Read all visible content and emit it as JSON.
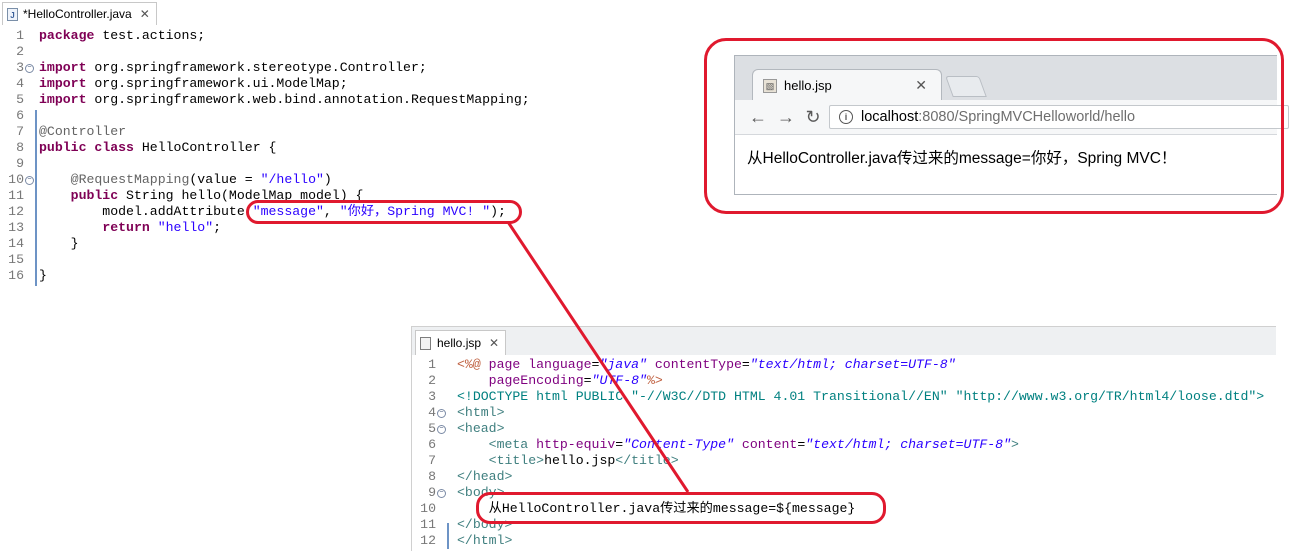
{
  "java_editor": {
    "tab_title": "*HelloController.java",
    "file_icon": "java-file-icon",
    "lines": [
      {
        "n": "1",
        "segments": [
          {
            "t": "package",
            "c": "kw"
          },
          {
            "t": " test.actions;",
            "c": ""
          }
        ]
      },
      {
        "n": "2",
        "segments": []
      },
      {
        "n": "3",
        "fold": true,
        "segments": [
          {
            "t": "import",
            "c": "kw"
          },
          {
            "t": " org.springframework.stereotype.Controller;",
            "c": ""
          }
        ]
      },
      {
        "n": "4",
        "segments": [
          {
            "t": "import",
            "c": "kw"
          },
          {
            "t": " org.springframework.ui.ModelMap;",
            "c": ""
          }
        ]
      },
      {
        "n": "5",
        "segments": [
          {
            "t": "import",
            "c": "kw"
          },
          {
            "t": " org.springframework.web.bind.annotation.RequestMapping;",
            "c": ""
          }
        ]
      },
      {
        "n": "6",
        "segments": []
      },
      {
        "n": "7",
        "segments": [
          {
            "t": "@Controller",
            "c": "ann"
          }
        ]
      },
      {
        "n": "8",
        "segments": [
          {
            "t": "public",
            "c": "kw"
          },
          {
            "t": " ",
            "c": ""
          },
          {
            "t": "class",
            "c": "kw"
          },
          {
            "t": " HelloController {",
            "c": ""
          }
        ]
      },
      {
        "n": "9",
        "segments": []
      },
      {
        "n": "10",
        "fold": true,
        "segments": [
          {
            "t": "    @RequestMapping",
            "c": "ann"
          },
          {
            "t": "(value = ",
            "c": ""
          },
          {
            "t": "\"/hello\"",
            "c": "str"
          },
          {
            "t": ")",
            "c": ""
          }
        ]
      },
      {
        "n": "11",
        "segments": [
          {
            "t": "    ",
            "c": ""
          },
          {
            "t": "public",
            "c": "kw"
          },
          {
            "t": " String hello(ModelMap model) {",
            "c": ""
          }
        ]
      },
      {
        "n": "12",
        "segments": [
          {
            "t": "        model.addAttribute(",
            "c": ""
          },
          {
            "t": "\"message\"",
            "c": "str"
          },
          {
            "t": ", ",
            "c": ""
          },
          {
            "t": "\"你好，Spring MVC! \"",
            "c": "str"
          },
          {
            "t": ");",
            "c": ""
          }
        ]
      },
      {
        "n": "13",
        "segments": [
          {
            "t": "        ",
            "c": ""
          },
          {
            "t": "return",
            "c": "kw"
          },
          {
            "t": " ",
            "c": ""
          },
          {
            "t": "\"hello\"",
            "c": "str"
          },
          {
            "t": ";",
            "c": ""
          }
        ]
      },
      {
        "n": "14",
        "segments": [
          {
            "t": "    }",
            "c": ""
          }
        ]
      },
      {
        "n": "15",
        "segments": []
      },
      {
        "n": "16",
        "segments": [
          {
            "t": "}",
            "c": ""
          }
        ]
      }
    ]
  },
  "browser": {
    "tab_title": "hello.jsp",
    "favicon": "page-icon",
    "url_host": "localhost",
    "url_path": ":8080/SpringMVCHelloworld/hello",
    "content_text": "从HelloController.java传过来的message=你好，Spring MVC！",
    "back_icon": "back-arrow-icon",
    "forward_icon": "forward-arrow-icon",
    "reload_icon": "reload-icon"
  },
  "jsp_editor": {
    "tab_title": "hello.jsp",
    "lines": [
      {
        "n": "1",
        "segments": [
          {
            "t": "<%@",
            "c": "jspd"
          },
          {
            "t": " page ",
            "c": "attrn"
          },
          {
            "t": "language",
            "c": "attrn"
          },
          {
            "t": "=",
            "c": ""
          },
          {
            "t": "\"java\"",
            "c": "attrv"
          },
          {
            "t": " contentType",
            "c": "attrn"
          },
          {
            "t": "=",
            "c": ""
          },
          {
            "t": "\"text/html; charset=UTF-8\"",
            "c": "attrv"
          }
        ]
      },
      {
        "n": "2",
        "segments": [
          {
            "t": "    pageEncoding",
            "c": "attrn"
          },
          {
            "t": "=",
            "c": ""
          },
          {
            "t": "\"UTF-8\"",
            "c": "attrv"
          },
          {
            "t": "%>",
            "c": "jspd"
          }
        ]
      },
      {
        "n": "3",
        "segments": [
          {
            "t": "<!DOCTYPE html PUBLIC ",
            "c": "doct"
          },
          {
            "t": "\"-//W3C//DTD HTML 4.01 Transitional//EN\" \"http://www.w3.org/TR/html4/loose.dtd\">",
            "c": "doct"
          }
        ]
      },
      {
        "n": "4",
        "fold": true,
        "segments": [
          {
            "t": "<html>",
            "c": "tag"
          }
        ]
      },
      {
        "n": "5",
        "fold": true,
        "segments": [
          {
            "t": "<head>",
            "c": "tag"
          }
        ]
      },
      {
        "n": "6",
        "segments": [
          {
            "t": "    <meta",
            "c": "tag"
          },
          {
            "t": " http-equiv",
            "c": "attrn"
          },
          {
            "t": "=",
            "c": ""
          },
          {
            "t": "\"Content-Type\"",
            "c": "attrv"
          },
          {
            "t": " content",
            "c": "attrn"
          },
          {
            "t": "=",
            "c": ""
          },
          {
            "t": "\"text/html; charset=UTF-8\"",
            "c": "attrv"
          },
          {
            "t": ">",
            "c": "tag"
          }
        ]
      },
      {
        "n": "7",
        "segments": [
          {
            "t": "    <title>",
            "c": "tag"
          },
          {
            "t": "hello.jsp",
            "c": ""
          },
          {
            "t": "</title>",
            "c": "tag"
          }
        ]
      },
      {
        "n": "8",
        "segments": [
          {
            "t": "</head>",
            "c": "tag"
          }
        ]
      },
      {
        "n": "9",
        "fold": true,
        "segments": [
          {
            "t": "<body>",
            "c": "tag"
          }
        ]
      },
      {
        "n": "10",
        "segments": [
          {
            "t": "    从HelloController.java传过来的message=${message}",
            "c": ""
          }
        ]
      },
      {
        "n": "11",
        "segments": [
          {
            "t": "</body>",
            "c": "tag"
          }
        ]
      },
      {
        "n": "12",
        "segments": [
          {
            "t": "</html>",
            "c": "tag"
          }
        ]
      }
    ]
  },
  "annotations": {
    "color": "#e0192e"
  }
}
